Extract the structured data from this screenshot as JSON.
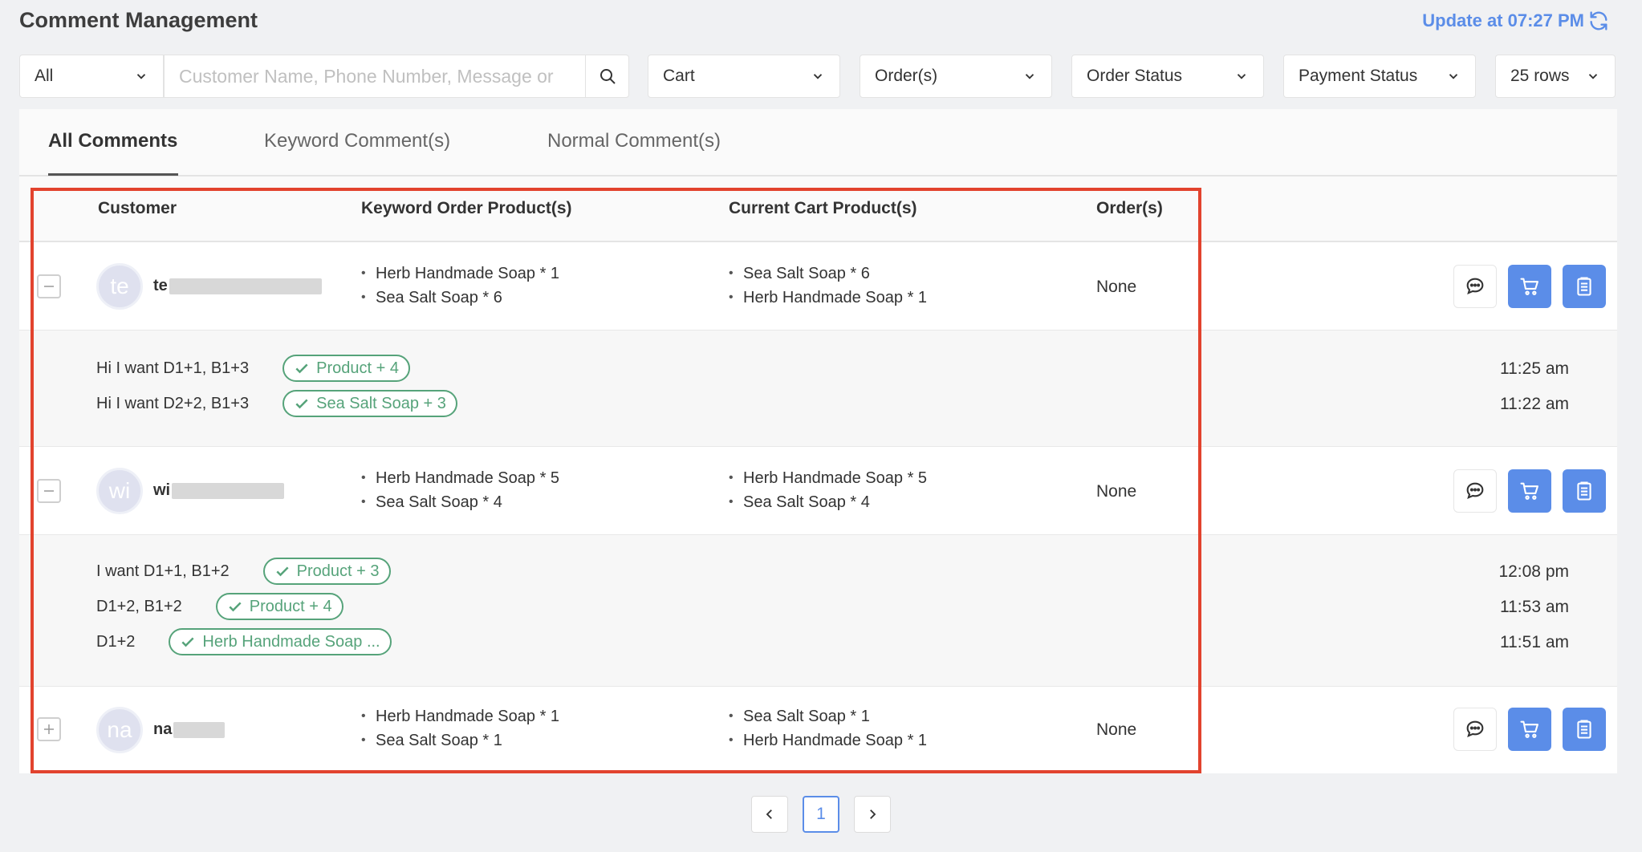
{
  "header": {
    "title": "Comment Management",
    "update_text": "Update at 07:27 PM"
  },
  "filters": {
    "scope": "All",
    "search_placeholder": "Customer Name, Phone Number, Message or",
    "cart": "Cart",
    "orders": "Order(s)",
    "order_status": "Order Status",
    "payment_status": "Payment Status",
    "rows": "25 rows"
  },
  "tabs": [
    {
      "label": "All Comments",
      "active": true
    },
    {
      "label": "Keyword Comment(s)",
      "active": false
    },
    {
      "label": "Normal Comment(s)",
      "active": false
    }
  ],
  "columns": {
    "customer": "Customer",
    "keyword": "Keyword Order Product(s)",
    "cart": "Current Cart Product(s)",
    "orders": "Order(s)"
  },
  "customers": [
    {
      "initials": "te",
      "name_prefix": "te",
      "expanded": true,
      "keyword_products": [
        "Herb Handmade Soap * 1",
        "Sea Salt Soap * 6"
      ],
      "cart_products": [
        "Sea Salt Soap * 6",
        "Herb Handmade Soap * 1"
      ],
      "orders": "None",
      "comments": [
        {
          "text": "Hi I want D1+1, B1+3",
          "tag": "Product + 4",
          "time": "11:25 am"
        },
        {
          "text": "Hi I want D2+2, B1+3",
          "tag": "Sea Salt Soap + 3",
          "time": "11:22 am"
        }
      ]
    },
    {
      "initials": "wi",
      "name_prefix": "wi",
      "expanded": true,
      "keyword_products": [
        "Herb Handmade Soap * 5",
        "Sea Salt Soap * 4"
      ],
      "cart_products": [
        "Herb Handmade Soap * 5",
        "Sea Salt Soap * 4"
      ],
      "orders": "None",
      "comments": [
        {
          "text": "I want D1+1, B1+2",
          "tag": "Product + 3",
          "time": "12:08 pm"
        },
        {
          "text": "D1+2, B1+2",
          "tag": "Product + 4",
          "time": "11:53 am"
        },
        {
          "text": "D1+2",
          "tag": "Herb Handmade Soap ...",
          "time": "11:51 am"
        }
      ]
    },
    {
      "initials": "na",
      "name_prefix": "na",
      "expanded": false,
      "keyword_products": [
        "Herb Handmade Soap * 1",
        "Sea Salt Soap * 1"
      ],
      "cart_products": [
        "Sea Salt Soap * 1",
        "Herb Handmade Soap * 1"
      ],
      "orders": "None",
      "comments": []
    }
  ],
  "pagination": {
    "current": "1"
  },
  "colors": {
    "accent": "#5b8de8",
    "tag_green": "#56a37a",
    "highlight_red": "#e2432e"
  },
  "icons": [
    "refresh-icon",
    "chevron-down-icon",
    "search-icon",
    "minus-icon",
    "plus-icon",
    "chat-icon",
    "cart-icon",
    "clipboard-icon",
    "chevron-left-icon",
    "chevron-right-icon",
    "check-icon"
  ]
}
